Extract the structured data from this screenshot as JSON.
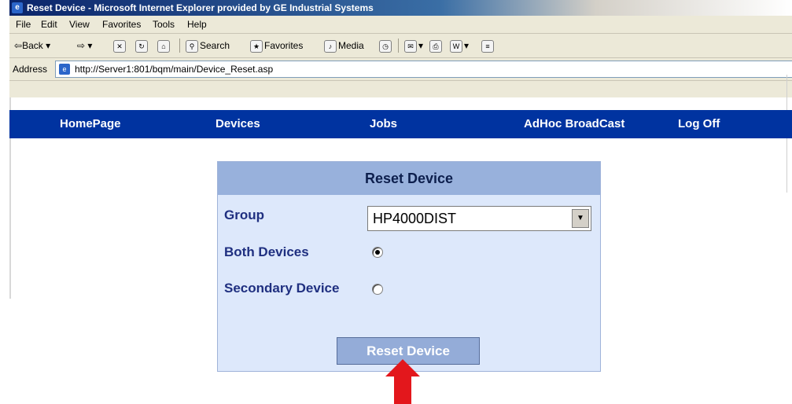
{
  "window": {
    "title": "Reset Device - Microsoft Internet Explorer provided by GE Industrial Systems"
  },
  "menu": [
    "File",
    "Edit",
    "View",
    "Favorites",
    "Tools",
    "Help"
  ],
  "toolbar": {
    "back": "Back",
    "search": "Search",
    "favorites": "Favorites",
    "media": "Media"
  },
  "address": {
    "label": "Address",
    "url": "http://Server1:801/bqm/main/Device_Reset.asp"
  },
  "nav": [
    "HomePage",
    "Devices",
    "Jobs",
    "AdHoc BroadCast",
    "Log Off"
  ],
  "panel": {
    "title": "Reset Device",
    "group_label": "Group",
    "group_value": "HP4000DIST",
    "both_label": "Both Devices",
    "both_checked": true,
    "secondary_label": "Secondary Device",
    "secondary_checked": false,
    "button_label": "Reset Device"
  },
  "colors": {
    "nav_bar": "#0033a0",
    "panel_bg": "#dde8fb",
    "panel_header": "#98b1dc",
    "label_text": "#1f2f80",
    "arrow": "#e3171c"
  }
}
